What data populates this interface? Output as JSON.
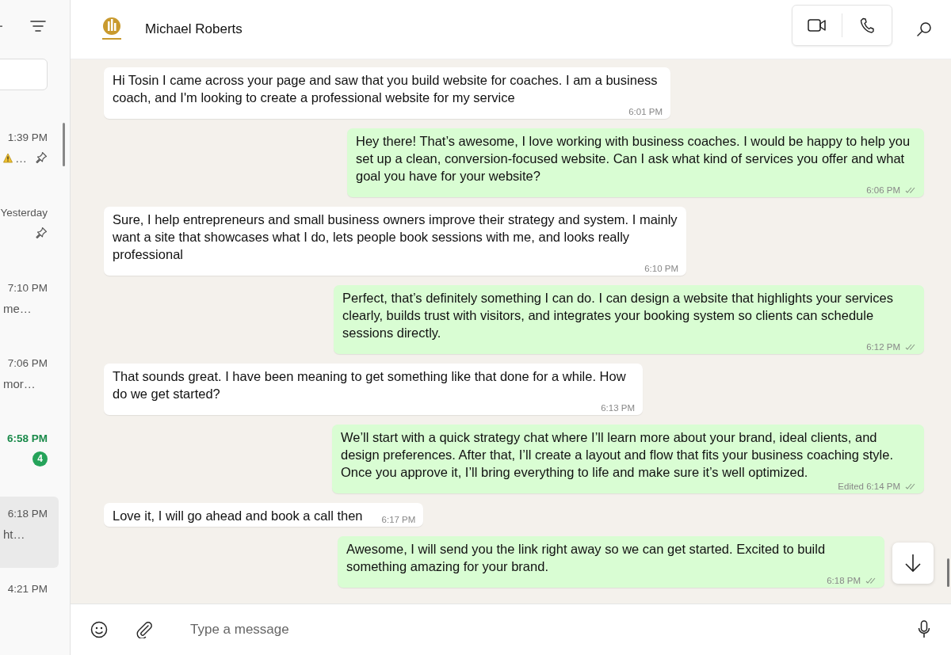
{
  "sidebar": {
    "chats": [
      {
        "time": "1:39 PM",
        "preview": "…",
        "warning": true,
        "pinned": true,
        "selected": false
      },
      {
        "time": "Yesterday",
        "pinned": true,
        "selected": false
      },
      {
        "time": "7:10 PM",
        "preview": "me…",
        "pinned": false,
        "selected": false
      },
      {
        "time": "7:06 PM",
        "preview": "mor…",
        "pinned": false,
        "selected": false
      },
      {
        "time": "6:58 PM",
        "pinned": false,
        "unread": "4",
        "selected": false
      },
      {
        "time": "6:18 PM",
        "preview": "ht…",
        "pinned": false,
        "selected": true
      },
      {
        "time": "4:21 PM",
        "pinned": false,
        "selected": false
      }
    ]
  },
  "chat": {
    "contact": "Michael Roberts",
    "messages": [
      {
        "kind": "incoming",
        "text": "Hi Tosin I came across your page and saw that you build website for coaches. I am a business coach, and I'm looking to create a professional website for my service",
        "meta": "6:01 PM"
      },
      {
        "kind": "outgoing",
        "text": "Hey there! That’s awesome, I love working with business coaches. I would be happy to help you set up a clean, conversion-focused website. Can I ask what kind of services you offer and what goal you have for your website?",
        "meta": "6:06 PM"
      },
      {
        "kind": "incoming",
        "text": "Sure, I help entrepreneurs and small business owners improve their strategy and system. I mainly want a site that showcases what I do, lets people book sessions with me, and looks really professional",
        "meta": "6:10 PM"
      },
      {
        "kind": "outgoing",
        "text": "Perfect, that’s definitely something I can do. I can design a website that highlights your services clearly, builds trust with visitors, and integrates your booking system so clients can schedule sessions directly.",
        "meta": "6:12 PM"
      },
      {
        "kind": "incoming",
        "text": "That sounds great. I have been meaning to get something like that done for a while. How do we get started?",
        "meta": "6:13 PM"
      },
      {
        "kind": "outgoing",
        "text": "We’ll start with a quick strategy chat where I’ll learn more about your brand, ideal clients, and design preferences. After that, I’ll create a layout and flow that fits your business coaching style. Once you approve it, I’ll bring everything to life and make sure it’s well optimized.",
        "meta": "Edited 6:14 PM"
      },
      {
        "kind": "incoming",
        "text": "Love it, I will go ahead and book a call then",
        "meta": "6:17 PM"
      },
      {
        "kind": "outgoing",
        "text": "Awesome, I will send you the link right away so we can get started. Excited to build something amazing for your brand.",
        "meta": "6:18 PM"
      }
    ],
    "composer": {
      "placeholder": "Type a message"
    }
  }
}
